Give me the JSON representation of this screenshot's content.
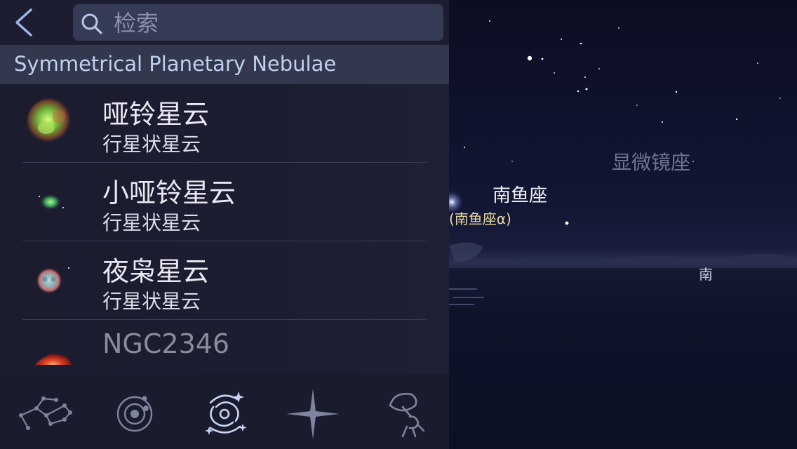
{
  "search": {
    "placeholder": "检索",
    "value": ""
  },
  "section": {
    "title": "Symmetrical Planetary Nebulae"
  },
  "items": [
    {
      "name": "哑铃星云",
      "type": "行星状星云",
      "thumb": "green-nebula"
    },
    {
      "name": "小哑铃星云",
      "type": "行星状星云",
      "thumb": "small-green-nebula"
    },
    {
      "name": "夜枭星云",
      "type": "行星状星云",
      "thumb": "owl-nebula"
    },
    {
      "name": "NGC2346",
      "type": "",
      "thumb": "red-nebula"
    }
  ],
  "tabs": [
    {
      "id": "constellations",
      "icon": "constellation-icon"
    },
    {
      "id": "solar-system",
      "icon": "solar-system-icon"
    },
    {
      "id": "deep-sky",
      "icon": "galaxy-icon",
      "active": true
    },
    {
      "id": "stars",
      "icon": "star-icon"
    },
    {
      "id": "satellites",
      "icon": "satellite-icon"
    }
  ],
  "sky": {
    "labels": {
      "microscopium": "显微镜座",
      "piscis_austrinus": "南鱼座",
      "fomalhaut": "(南鱼座α)",
      "south": "南"
    }
  },
  "colors": {
    "accent": "#bfd1ee",
    "panel": "#1c1d31",
    "active_tab": "#c8d4f4",
    "inactive_tab": "#7f849e"
  }
}
